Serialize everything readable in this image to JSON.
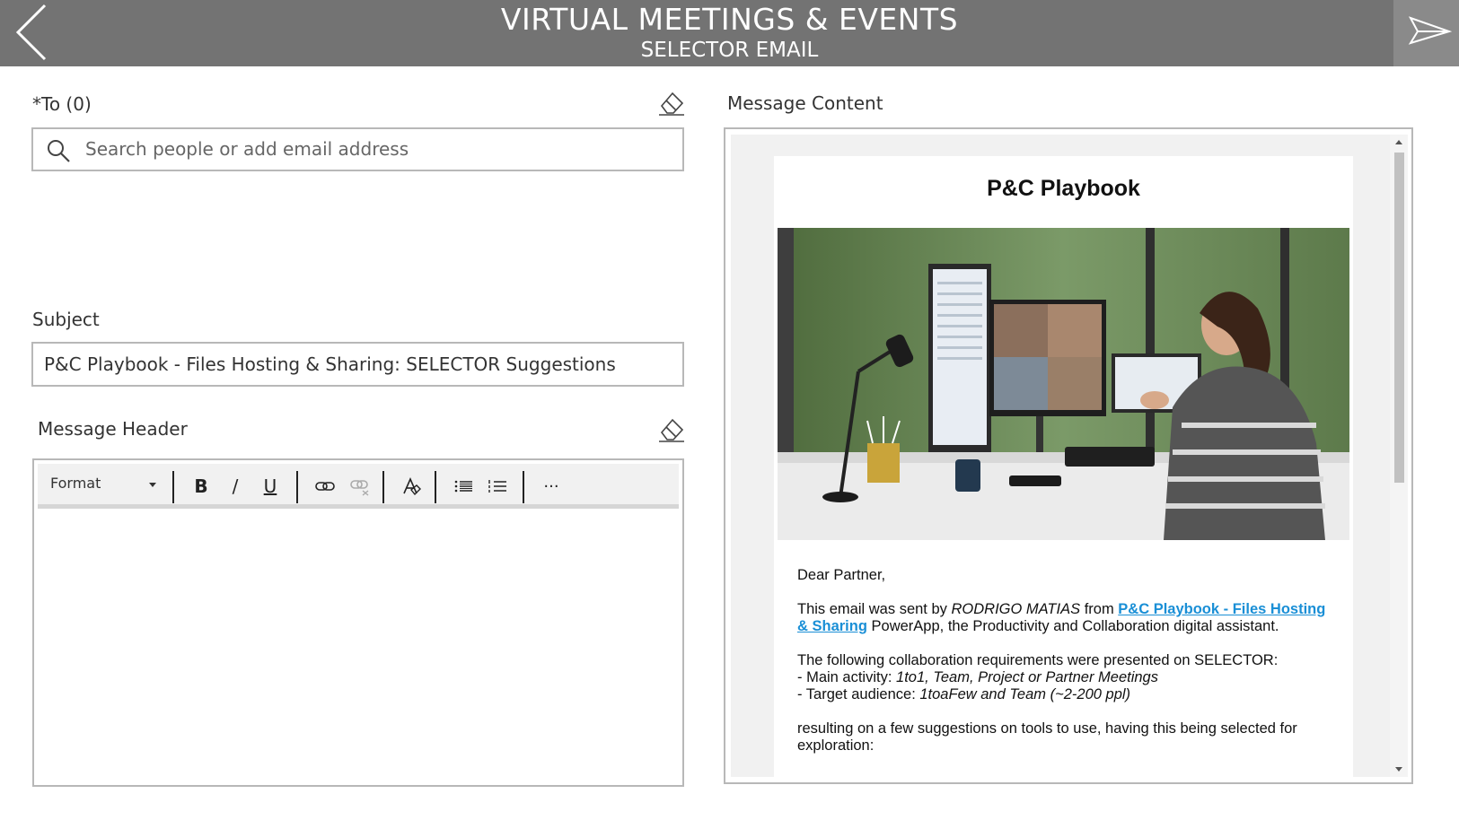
{
  "header": {
    "title": "VIRTUAL MEETINGS & EVENTS",
    "subtitle": "SELECTOR EMAIL",
    "back_icon": "chevron-left-icon",
    "send_icon": "send-icon",
    "background": "#737373"
  },
  "to": {
    "label": "*To (0)",
    "placeholder": "Search people or add email address",
    "value": ""
  },
  "subject": {
    "label": "Subject",
    "value": "P&C Playbook - Files Hosting & Sharing: SELECTOR Suggestions"
  },
  "message_header": {
    "label": "Message Header",
    "toolbar": {
      "format_label": "Format",
      "buttons": [
        "bold-icon",
        "italic-icon",
        "underline-icon",
        "link-icon",
        "unlink-icon",
        "clear-format-icon",
        "bulleted-list-icon",
        "numbered-list-icon",
        "more-icon"
      ],
      "bold": "B",
      "italic": "/",
      "underline": "U",
      "more": "···"
    },
    "body": ""
  },
  "message_content": {
    "label": "Message Content",
    "email": {
      "title": "P&C Playbook",
      "greeting": "Dear Partner,",
      "p1_prefix": "This email was sent by ",
      "p1_sender": "RODRIGO MATIAS",
      "p1_from": " from ",
      "p1_link": "P&C Playbook - Files Hosting & Sharing",
      "p1_suffix": " PowerApp, the Productivity and Collaboration digital assistant.",
      "p2_intro": "The following collaboration requirements were presented on SELECTOR:",
      "p2_main_label": "- Main activity: ",
      "p2_main_value": "1to1, Team, Project or Partner Meetings",
      "p2_target_label": "- Target audience: ",
      "p2_target_value": "1toaFew and Team (~2-200 ppl)",
      "p3": "resulting on a few suggestions on tools to use, having this being selected for exploration:"
    }
  },
  "colors": {
    "link": "#1a8fd6",
    "border": "#b8b8b8",
    "panel_bg": "#f1f1f1"
  }
}
